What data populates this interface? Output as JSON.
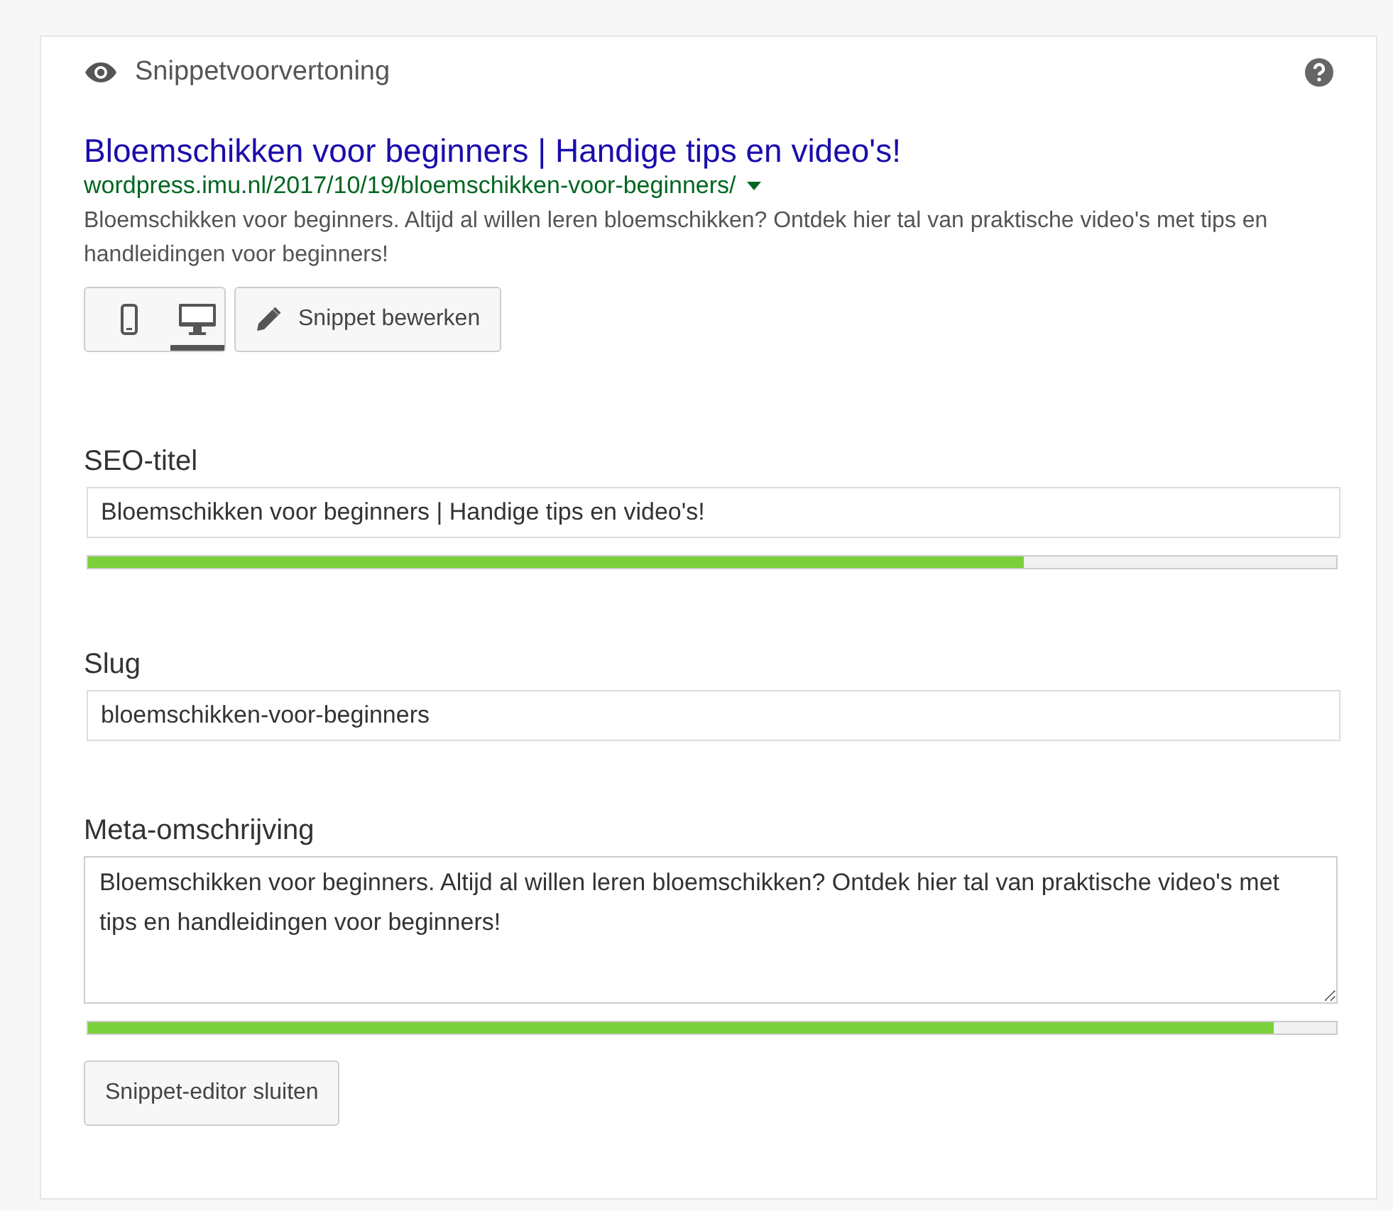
{
  "panel": {
    "title": "Snippetvoorvertoning"
  },
  "preview": {
    "title": "Bloemschikken voor beginners | Handige tips en video's!",
    "url": "wordpress.imu.nl/2017/10/19/bloemschikken-voor-beginners/",
    "description": "Bloemschikken voor beginners. Altijd al willen leren bloemschikken? Ontdek hier tal van praktische video's met tips en handleidingen voor beginners!"
  },
  "devices": [
    {
      "kind": "mobile",
      "selected": false
    },
    {
      "kind": "desktop",
      "selected": true
    }
  ],
  "edit_button": "Snippet bewerken",
  "fields": [
    {
      "kind": "input",
      "label": "SEO-titel",
      "value": "Bloemschikken voor beginners | Handige tips en video's!",
      "level": 0.75
    },
    {
      "kind": "input",
      "label": "Slug",
      "value": "bloemschikken-voor-beginners"
    },
    {
      "kind": "textarea",
      "label": "Meta-omschrijving",
      "value": "Bloemschikken voor beginners. Altijd al willen leren bloemschikken? Ontdek hier tal van praktische video's met tips en handleidingen voor beginners!",
      "level": 0.95
    }
  ],
  "close_button": "Snippet-editor sluiten"
}
